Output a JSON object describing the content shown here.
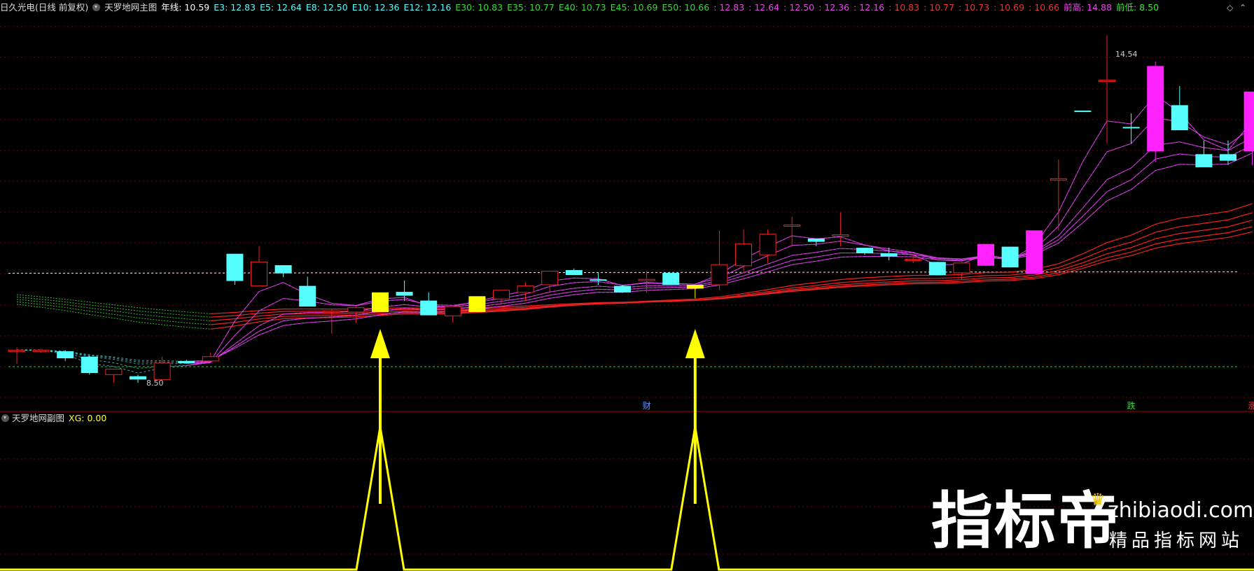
{
  "header": {
    "stock": "日久光电(日线 前复权)",
    "indicator": "天罗地网主图",
    "items": [
      {
        "label": "年线: 10.59",
        "color": "#ffffff"
      },
      {
        "label": "E3: 12.83",
        "color": "#55ffff"
      },
      {
        "label": "E5: 12.64",
        "color": "#55ffff"
      },
      {
        "label": "E8: 12.50",
        "color": "#55ffff"
      },
      {
        "label": "E10: 12.36",
        "color": "#55ffff"
      },
      {
        "label": "E12: 12.16",
        "color": "#55ffff"
      },
      {
        "label": "E30: 10.83",
        "color": "#33dd33"
      },
      {
        "label": "E35: 10.77",
        "color": "#33dd33"
      },
      {
        "label": "E40: 10.73",
        "color": "#33dd33"
      },
      {
        "label": "E45: 10.69",
        "color": "#33dd33"
      },
      {
        "label": "E50: 10.66",
        "color": "#33dd33"
      },
      {
        "label": ": 12.83",
        "color": "#ee44ee"
      },
      {
        "label": ": 12.64",
        "color": "#ee44ee"
      },
      {
        "label": ": 12.50",
        "color": "#ee44ee"
      },
      {
        "label": ": 12.36",
        "color": "#ee44ee"
      },
      {
        "label": ": 12.16",
        "color": "#ee44ee"
      },
      {
        "label": ": 10.83",
        "color": "#ee3333"
      },
      {
        "label": ": 10.77",
        "color": "#ee3333"
      },
      {
        "label": ": 10.73",
        "color": "#ee3333"
      },
      {
        "label": ": 10.69",
        "color": "#ee3333"
      },
      {
        "label": ": 10.66",
        "color": "#ee3333"
      },
      {
        "label": "前高: 14.88",
        "color": "#ee44ee"
      },
      {
        "label": "前低: 8.50",
        "color": "#33ee33"
      }
    ]
  },
  "sub_header": {
    "indicator": "天罗地网副图",
    "xg": "XG: 0.00"
  },
  "corner_icons": [
    "diamond-icon",
    "up-icon"
  ],
  "watermark": {
    "brand": "指标帝",
    "site": "zhibiaodi.com",
    "tagline": "精品指标网站"
  },
  "chart_data": [
    {
      "type": "candlestick",
      "ylim": [
        8.05,
        15.25
      ],
      "annotations": [
        {
          "text": "14.54",
          "value": 14.54,
          "bar": 45
        },
        {
          "text": "8.50",
          "value": 8.5,
          "bar": 5
        }
      ],
      "markers": [
        {
          "text": "财",
          "bar": 26,
          "color": "#6699ff"
        },
        {
          "text": "跌",
          "bar": 46,
          "color": "#33dd33"
        },
        {
          "text": "涨",
          "bar": 51,
          "color": "#ff4444"
        }
      ],
      "reference_lines": {
        "yearly_line": 10.59,
        "prev_low": 8.5
      },
      "candles": [
        {
          "o": 9.1,
          "h": 9.15,
          "l": 8.85,
          "c": 9.1,
          "color": "red"
        },
        {
          "o": 9.1,
          "h": 9.12,
          "l": 9.05,
          "c": 9.1,
          "color": "red"
        },
        {
          "o": 9.08,
          "h": 9.1,
          "l": 8.9,
          "c": 8.95,
          "color": "cyan"
        },
        {
          "o": 8.98,
          "h": 9.0,
          "l": 8.65,
          "c": 8.68,
          "color": "cyan"
        },
        {
          "o": 8.65,
          "h": 8.75,
          "l": 8.5,
          "c": 8.75,
          "color": "red"
        },
        {
          "o": 8.62,
          "h": 8.65,
          "l": 8.5,
          "c": 8.56,
          "color": "cyan"
        },
        {
          "o": 8.56,
          "h": 8.98,
          "l": 8.56,
          "c": 8.86,
          "color": "red"
        },
        {
          "o": 8.9,
          "h": 8.92,
          "l": 8.85,
          "c": 8.86,
          "color": "cyan"
        },
        {
          "o": 8.9,
          "h": 9.05,
          "l": 8.9,
          "c": 8.98,
          "color": "red"
        },
        {
          "o": 10.87,
          "h": 10.87,
          "l": 10.3,
          "c": 10.37,
          "color": "cyan"
        },
        {
          "o": 10.28,
          "h": 11.01,
          "l": 10.28,
          "c": 10.72,
          "color": "red"
        },
        {
          "o": 10.66,
          "h": 10.66,
          "l": 10.44,
          "c": 10.51,
          "color": "cyan"
        },
        {
          "o": 10.28,
          "h": 10.45,
          "l": 9.9,
          "c": 9.9,
          "color": "cyan"
        },
        {
          "o": 9.82,
          "h": 9.85,
          "l": 9.4,
          "c": 9.8,
          "color": "red"
        },
        {
          "o": 9.8,
          "h": 9.9,
          "l": 9.6,
          "c": 9.88,
          "color": "red"
        },
        {
          "o": 9.8,
          "h": 10.16,
          "l": 9.8,
          "c": 10.16,
          "color": "yellow"
        },
        {
          "o": 10.17,
          "h": 10.38,
          "l": 10.0,
          "c": 10.1,
          "color": "cyan"
        },
        {
          "o": 10.01,
          "h": 10.16,
          "l": 9.74,
          "c": 9.74,
          "color": "cyan"
        },
        {
          "o": 9.73,
          "h": 9.86,
          "l": 9.6,
          "c": 9.9,
          "color": "red"
        },
        {
          "o": 9.8,
          "h": 10.09,
          "l": 9.8,
          "c": 10.09,
          "color": "yellow"
        },
        {
          "o": 10.04,
          "h": 10.19,
          "l": 9.95,
          "c": 10.2,
          "color": "red"
        },
        {
          "o": 10.16,
          "h": 10.35,
          "l": 10.0,
          "c": 10.28,
          "color": "red"
        },
        {
          "o": 10.3,
          "h": 10.55,
          "l": 10.15,
          "c": 10.55,
          "color": "red"
        },
        {
          "o": 10.57,
          "h": 10.6,
          "l": 10.48,
          "c": 10.48,
          "color": "cyan"
        },
        {
          "o": 10.4,
          "h": 10.52,
          "l": 10.3,
          "c": 10.4,
          "color": "cyan"
        },
        {
          "o": 10.28,
          "h": 10.3,
          "l": 10.15,
          "c": 10.16,
          "color": "cyan"
        },
        {
          "o": 10.38,
          "h": 10.55,
          "l": 10.15,
          "c": 10.4,
          "color": "red"
        },
        {
          "o": 10.52,
          "h": 10.52,
          "l": 10.3,
          "c": 10.3,
          "color": "cyan"
        },
        {
          "o": 10.23,
          "h": 10.3,
          "l": 10.05,
          "c": 10.3,
          "color": "yellow"
        },
        {
          "o": 10.3,
          "h": 11.3,
          "l": 10.2,
          "c": 10.67,
          "color": "red"
        },
        {
          "o": 10.65,
          "h": 11.32,
          "l": 10.55,
          "c": 11.05,
          "color": "red"
        },
        {
          "o": 10.85,
          "h": 11.32,
          "l": 10.7,
          "c": 11.23,
          "color": "red"
        },
        {
          "o": 11.4,
          "h": 11.55,
          "l": 11.0,
          "c": 11.4,
          "color": "red"
        },
        {
          "o": 11.15,
          "h": 11.15,
          "l": 11.01,
          "c": 11.09,
          "color": "cyan"
        },
        {
          "o": 11.22,
          "h": 11.63,
          "l": 11.01,
          "c": 11.22,
          "color": "red"
        },
        {
          "o": 10.98,
          "h": 10.98,
          "l": 10.85,
          "c": 10.88,
          "color": "cyan"
        },
        {
          "o": 10.88,
          "h": 10.98,
          "l": 10.75,
          "c": 10.82,
          "color": "cyan"
        },
        {
          "o": 10.77,
          "h": 10.85,
          "l": 10.7,
          "c": 10.77,
          "color": "red"
        },
        {
          "o": 10.72,
          "h": 10.72,
          "l": 10.48,
          "c": 10.48,
          "color": "cyan"
        },
        {
          "o": 10.52,
          "h": 10.72,
          "l": 10.4,
          "c": 10.7,
          "color": "red"
        },
        {
          "o": 10.65,
          "h": 11.05,
          "l": 10.65,
          "c": 11.05,
          "color": "magenta"
        },
        {
          "o": 11.0,
          "h": 11.0,
          "l": 10.62,
          "c": 10.62,
          "color": "cyan"
        },
        {
          "o": 10.5,
          "h": 11.3,
          "l": 10.5,
          "c": 11.3,
          "color": "magenta"
        },
        {
          "o": 12.25,
          "h": 12.6,
          "l": 11.3,
          "c": 12.25,
          "color": "red"
        },
        {
          "o": 13.5,
          "h": 13.5,
          "l": 13.48,
          "c": 13.49,
          "color": "cyan"
        },
        {
          "o": 14.06,
          "h": 14.88,
          "l": 12.9,
          "c": 14.06,
          "color": "red"
        },
        {
          "o": 13.2,
          "h": 13.45,
          "l": 12.9,
          "c": 13.2,
          "color": "cyan"
        },
        {
          "o": 12.75,
          "h": 14.4,
          "l": 12.55,
          "c": 14.32,
          "color": "magenta"
        },
        {
          "o": 13.6,
          "h": 13.95,
          "l": 13.15,
          "c": 13.14,
          "color": "cyan"
        },
        {
          "o": 12.7,
          "h": 12.95,
          "l": 12.5,
          "c": 12.46,
          "color": "cyan"
        },
        {
          "o": 12.7,
          "h": 12.95,
          "l": 12.5,
          "c": 12.58,
          "color": "cyan"
        },
        {
          "o": 12.75,
          "h": 13.85,
          "l": 12.5,
          "c": 13.85,
          "color": "magenta"
        }
      ]
    },
    {
      "type": "line",
      "xg_value": 0.0,
      "signals": [
        {
          "bar": 15,
          "value": 1
        },
        {
          "bar": 28,
          "value": 1
        }
      ]
    }
  ]
}
